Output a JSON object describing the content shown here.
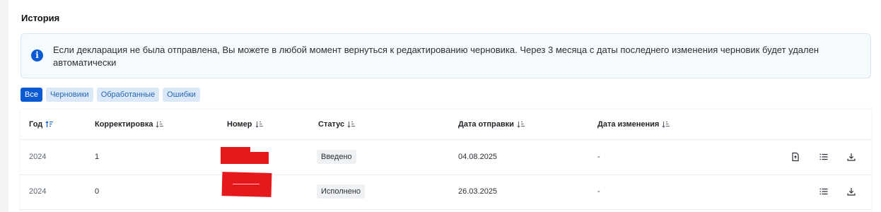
{
  "section": {
    "title": "История"
  },
  "info": {
    "icon": "info-icon",
    "text": "Если декларация не была отправлена, Вы можете в любой момент вернуться к редактированию черновика. Через 3 месяца с даты последнего изменения черновик будет удален автоматически"
  },
  "filters": [
    {
      "label": "Все",
      "active": true
    },
    {
      "label": "Черновики",
      "active": false
    },
    {
      "label": "Обработанные",
      "active": false
    },
    {
      "label": "Ошибки",
      "active": false
    }
  ],
  "table": {
    "columns": [
      {
        "label": "Год",
        "sort_icon": "sort-asc-active-icon"
      },
      {
        "label": "Корректировка",
        "sort_icon": "sort-icon"
      },
      {
        "label": "Номер",
        "sort_icon": "sort-icon"
      },
      {
        "label": "Статус",
        "sort_icon": "sort-icon"
      },
      {
        "label": "Дата отправки",
        "sort_icon": "sort-icon"
      },
      {
        "label": "Дата изменения",
        "sort_icon": "sort-icon"
      }
    ],
    "rows": [
      {
        "year": "2024",
        "correction": "1",
        "number": "",
        "number_redacted": true,
        "status": "Введено",
        "sent_date": "04.08.2025",
        "changed_date": "-",
        "actions": [
          "document-icon",
          "list-icon",
          "download-icon"
        ]
      },
      {
        "year": "2024",
        "correction": "0",
        "number": "",
        "number_redacted": true,
        "status": "Исполнено",
        "sent_date": "26.03.2025",
        "changed_date": "-",
        "actions": [
          "list-icon",
          "download-icon"
        ]
      }
    ]
  },
  "colors": {
    "accent": "#0a5bd3",
    "chip_bg": "#dbe8f7",
    "redaction": "#e5191c"
  }
}
